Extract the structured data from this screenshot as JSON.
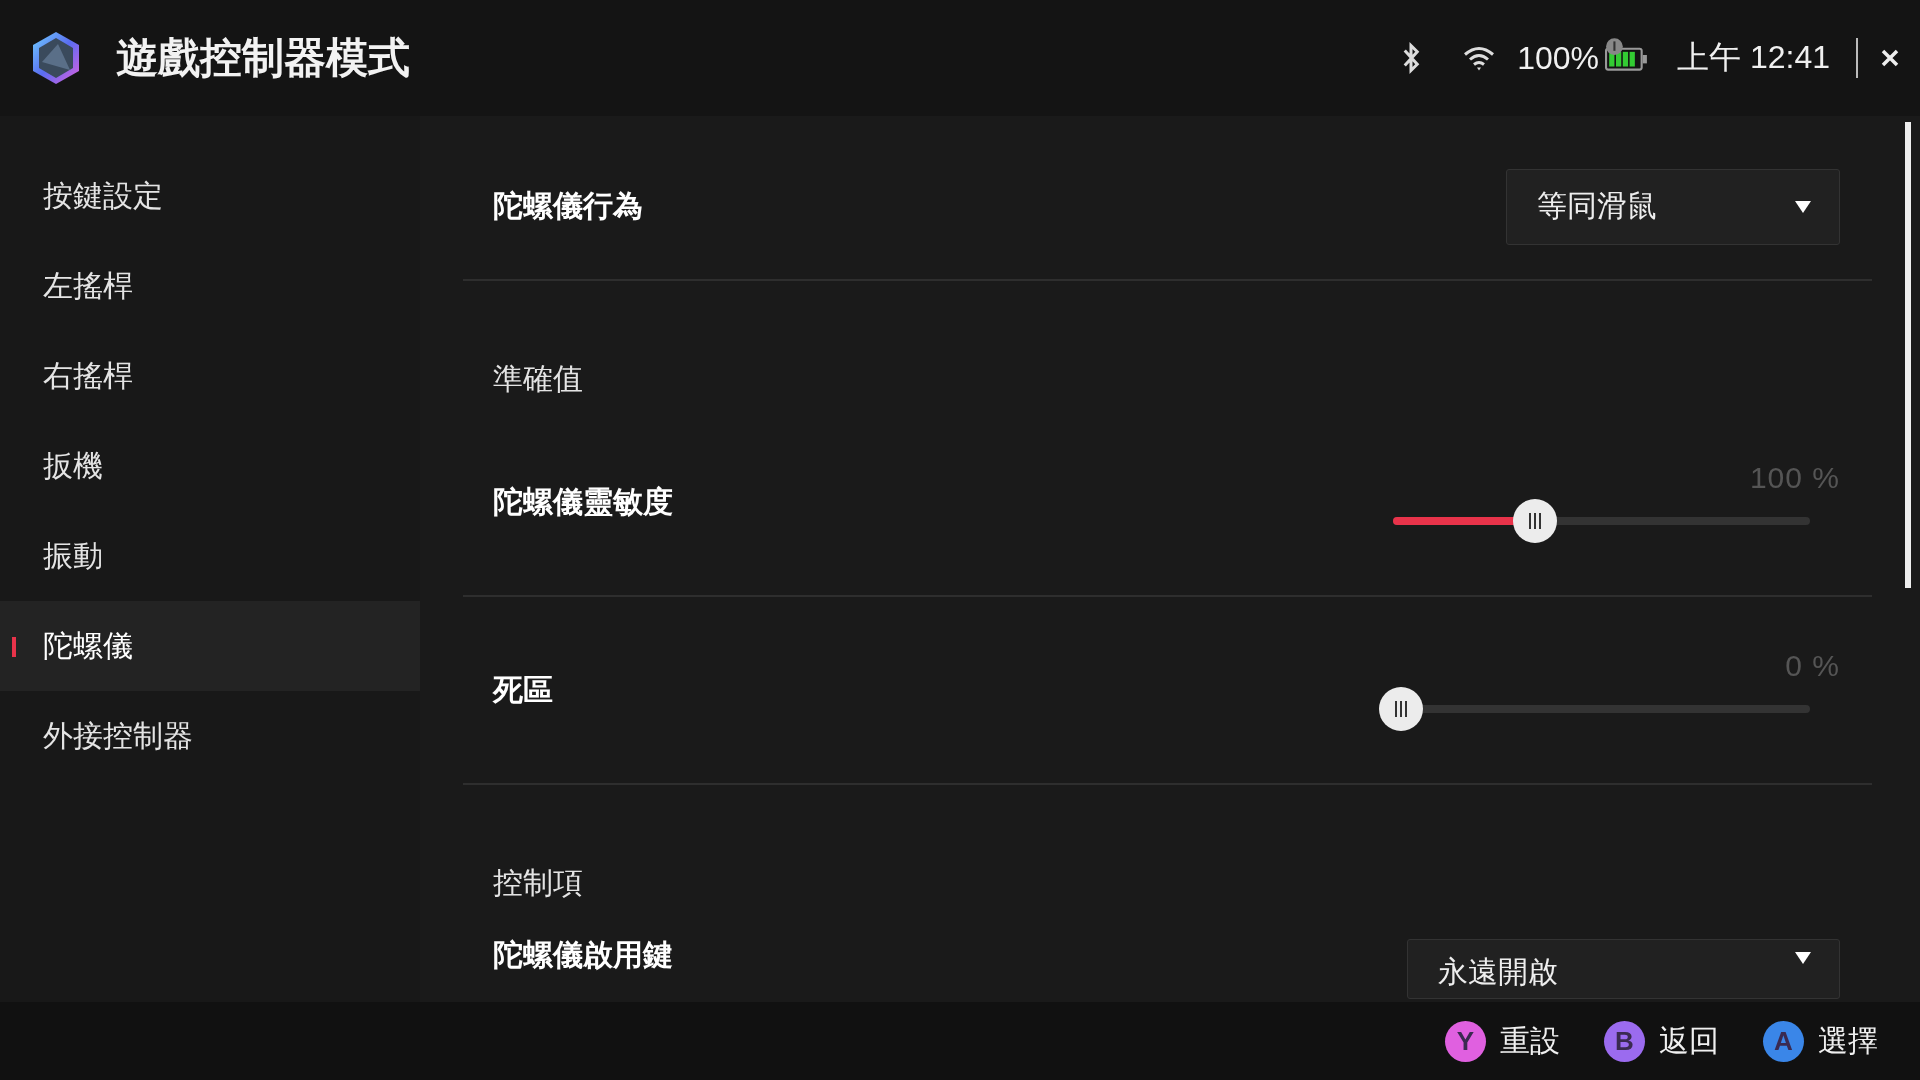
{
  "header": {
    "title": "遊戲控制器模式",
    "battery_percent": "100%",
    "time": "上午 12:41"
  },
  "sidebar": {
    "items": [
      {
        "label": "按鍵設定",
        "selected": false
      },
      {
        "label": "左搖桿",
        "selected": false
      },
      {
        "label": "右搖桿",
        "selected": false
      },
      {
        "label": "扳機",
        "selected": false
      },
      {
        "label": "振動",
        "selected": false
      },
      {
        "label": "陀螺儀",
        "selected": true
      },
      {
        "label": "外接控制器",
        "selected": false
      }
    ]
  },
  "settings": [
    {
      "kind": "dropdown",
      "label": "陀螺儀行為",
      "value": "等同滑鼠"
    },
    {
      "kind": "section",
      "label": "準確值"
    },
    {
      "kind": "slider",
      "label": "陀螺儀靈敏度",
      "reading": "100 %",
      "level": 0.34
    },
    {
      "kind": "slider",
      "label": "死區",
      "reading": "0 %",
      "level": 0
    },
    {
      "kind": "section",
      "label": "控制項"
    },
    {
      "kind": "dropdown",
      "label": "陀螺儀啟用鍵",
      "value": "永遠開啟"
    }
  ],
  "footer": {
    "buttons": [
      {
        "key": "Y",
        "label": "重設",
        "color": "#e060e0"
      },
      {
        "key": "B",
        "label": "返回",
        "color": "#9b6bef"
      },
      {
        "key": "A",
        "label": "選擇",
        "color": "#3a86e8"
      }
    ]
  }
}
